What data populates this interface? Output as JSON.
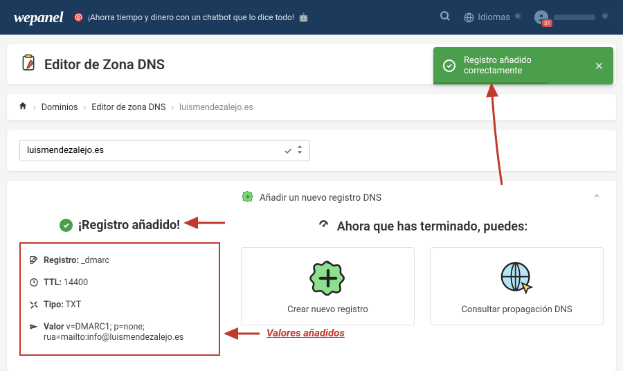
{
  "topbar": {
    "logo": "wepanel",
    "promo": "¡Ahorra tiempo y dinero con un chatbot que lo dice todo!",
    "idiomas_label": "Idiomas",
    "notification_count": "31"
  },
  "toast": {
    "text": "Registro añadido correctamente"
  },
  "page_title": "Editor de Zona DNS",
  "breadcrumb": {
    "home": "",
    "dominios": "Dominios",
    "editor": "Editor de zona DNS",
    "domain": "luismendezalejo.es"
  },
  "domain_select": {
    "value": "luismendezalejo.es"
  },
  "main": {
    "add_header": "Añadir un nuevo registro DNS",
    "success_title": "¡Registro añadido!",
    "record": {
      "registro_label": "Registro:",
      "registro_value": "_dmarc",
      "ttl_label": "TTL:",
      "ttl_value": "14400",
      "tipo_label": "Tipo:",
      "tipo_value": "TXT",
      "valor_label": "Valor",
      "valor_value": "v=DMARC1; p=none; rua=mailto:info@luismendezalejo.es"
    },
    "now_title": "Ahora que has terminado, puedes:",
    "action_create": "Crear nuevo registro",
    "action_consult": "Consultar propagación DNS"
  },
  "annotation": {
    "valores": "Valores añadidos"
  }
}
